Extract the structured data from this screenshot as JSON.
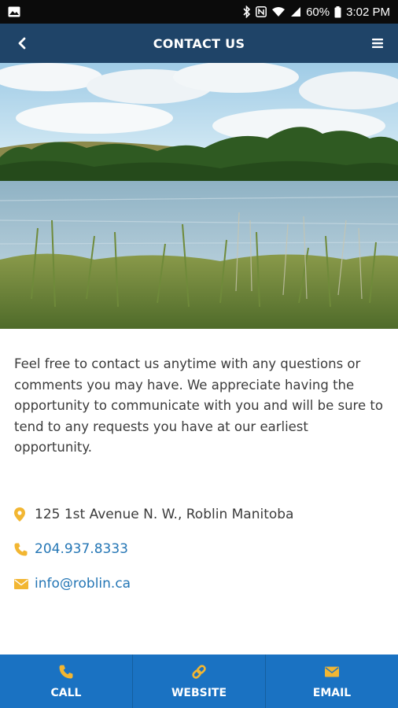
{
  "status_bar": {
    "battery": "60%",
    "time": "3:02 PM",
    "icons": [
      "image-icon",
      "bluetooth-icon",
      "nfc-icon",
      "wifi-icon",
      "signal-icon",
      "battery-icon"
    ]
  },
  "app_bar": {
    "title": "CONTACT US",
    "back_icon": "back-chevron-icon",
    "menu_icon": "hamburger-menu-icon",
    "color": "#1f4468"
  },
  "hero": {
    "description_icon": "lake-landscape-image"
  },
  "intro_text": "Feel free to contact us anytime with any questions or comments you may have. We appreciate having the opportunity to communicate with you and will be sure to tend to any requests you have at our earliest opportunity.",
  "contacts": {
    "address": "125 1st Avenue N. W., Roblin Manitoba",
    "phone": "204.937.8333",
    "email": "info@roblin.ca",
    "icon_color": "#f2b632",
    "link_color": "#2476b5"
  },
  "bottom_nav": {
    "color": "#1a72c2",
    "items": [
      {
        "label": "CALL",
        "icon": "phone-icon"
      },
      {
        "label": "WEBSITE",
        "icon": "link-icon"
      },
      {
        "label": "EMAIL",
        "icon": "envelope-icon"
      }
    ]
  }
}
